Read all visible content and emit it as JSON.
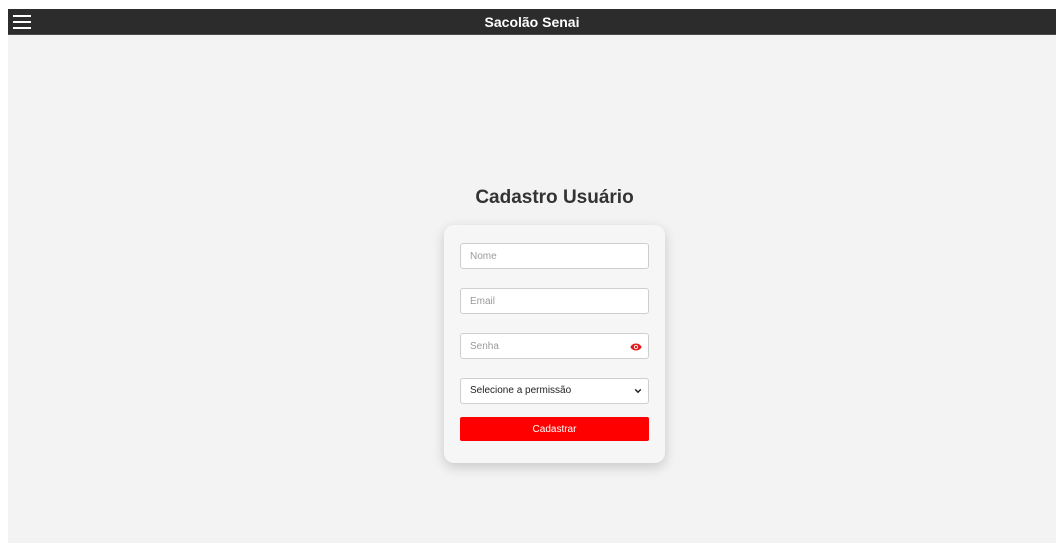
{
  "header": {
    "menu_icon": "hamburger-menu-icon",
    "title": "Sacolão Senai"
  },
  "page": {
    "title": "Cadastro Usuário"
  },
  "form": {
    "nome": {
      "placeholder": "Nome",
      "value": ""
    },
    "email": {
      "placeholder": "Email",
      "value": ""
    },
    "senha": {
      "placeholder": "Senha",
      "value": "",
      "toggle_icon": "eye-icon"
    },
    "permissao": {
      "selected_label": "Selecione a permissão",
      "icon": "chevron-down-icon"
    },
    "submit_label": "Cadastrar"
  },
  "colors": {
    "header_bg": "#2c2c2c",
    "page_bg": "#f3f3f3",
    "accent": "#ff0000",
    "card_bg": "#f6f6f6"
  }
}
